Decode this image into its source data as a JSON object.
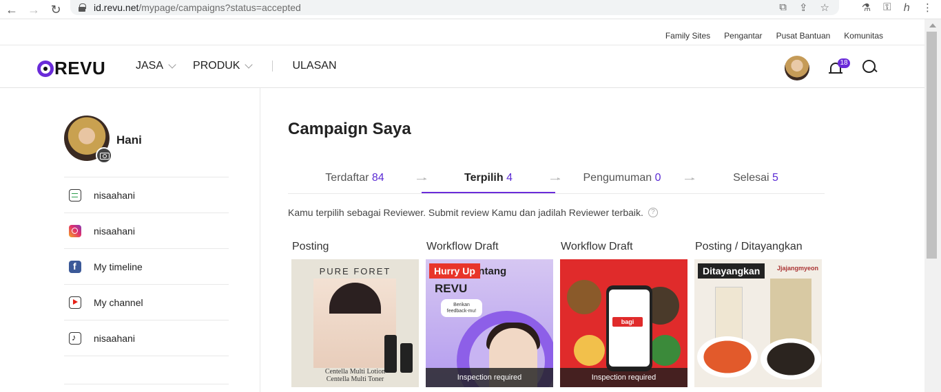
{
  "browser": {
    "url_host": "id.revu.net",
    "url_path": "/mypage/campaigns?status=accepted"
  },
  "utility_links": [
    "Family Sites",
    "Pengantar",
    "Pusat Bantuan",
    "Komunitas"
  ],
  "header": {
    "logo_text": "REVU",
    "menu": [
      "JASA",
      "PRODUK",
      "ULASAN"
    ],
    "notification_count": "18",
    "accent_color": "#6a2bd9"
  },
  "sidebar": {
    "name": "Hani",
    "channels": [
      {
        "icon": "blog-icon",
        "label": "nisaahani"
      },
      {
        "icon": "instagram-icon",
        "label": "nisaahani"
      },
      {
        "icon": "facebook-icon",
        "label": "My timeline"
      },
      {
        "icon": "youtube-icon",
        "label": "My channel"
      },
      {
        "icon": "tiktok-icon",
        "label": "nisaahani"
      }
    ]
  },
  "main": {
    "title": "Campaign Saya",
    "tabs": [
      {
        "label": "Terdaftar",
        "count": "84",
        "active": false
      },
      {
        "label": "Terpilih",
        "count": "4",
        "active": true
      },
      {
        "label": "Pengumuman",
        "count": "0",
        "active": false
      },
      {
        "label": "Selesai",
        "count": "5",
        "active": false
      }
    ],
    "notice": "Kamu terpilih sebagai Reviewer. Submit review Kamu dan jadilah Reviewer terbaik.",
    "help_glyph": "?",
    "cards": [
      {
        "status": "Posting",
        "brand": "PURE FORET",
        "caption_1": "Centella Multi Lotion",
        "caption_2": "Centella Multi Toner"
      },
      {
        "status": "Workflow Draft",
        "tag": "Hurry Up",
        "headline": "Tentang",
        "logo": "REVU",
        "bubble_1": "Berikan",
        "bubble_2": "feedback-mu!",
        "overlay": "Inspection required"
      },
      {
        "status": "Workflow Draft",
        "app_logo": "bagi",
        "overlay": "Inspection required"
      },
      {
        "status": "Posting / Ditayangkan",
        "tag": "Ditayangkan",
        "brand": "Jjajangmyeon"
      }
    ]
  }
}
